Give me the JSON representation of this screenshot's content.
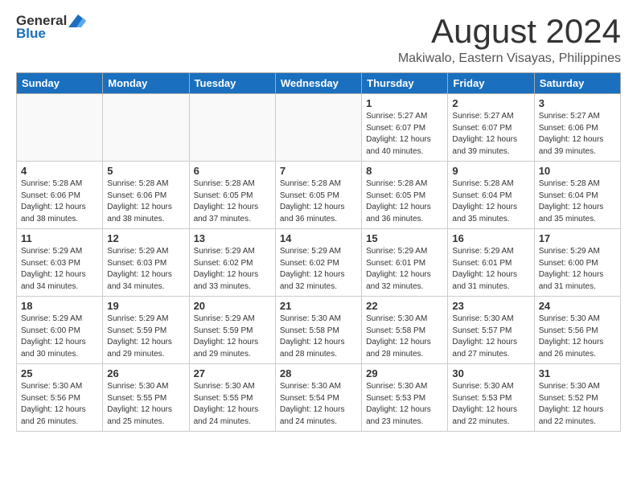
{
  "logo": {
    "general": "General",
    "blue": "Blue"
  },
  "title": "August 2024",
  "location": "Makiwalo, Eastern Visayas, Philippines",
  "days_header": [
    "Sunday",
    "Monday",
    "Tuesday",
    "Wednesday",
    "Thursday",
    "Friday",
    "Saturday"
  ],
  "weeks": [
    [
      {
        "day": "",
        "info": ""
      },
      {
        "day": "",
        "info": ""
      },
      {
        "day": "",
        "info": ""
      },
      {
        "day": "",
        "info": ""
      },
      {
        "day": "1",
        "info": "Sunrise: 5:27 AM\nSunset: 6:07 PM\nDaylight: 12 hours\nand 40 minutes."
      },
      {
        "day": "2",
        "info": "Sunrise: 5:27 AM\nSunset: 6:07 PM\nDaylight: 12 hours\nand 39 minutes."
      },
      {
        "day": "3",
        "info": "Sunrise: 5:27 AM\nSunset: 6:06 PM\nDaylight: 12 hours\nand 39 minutes."
      }
    ],
    [
      {
        "day": "4",
        "info": "Sunrise: 5:28 AM\nSunset: 6:06 PM\nDaylight: 12 hours\nand 38 minutes."
      },
      {
        "day": "5",
        "info": "Sunrise: 5:28 AM\nSunset: 6:06 PM\nDaylight: 12 hours\nand 38 minutes."
      },
      {
        "day": "6",
        "info": "Sunrise: 5:28 AM\nSunset: 6:05 PM\nDaylight: 12 hours\nand 37 minutes."
      },
      {
        "day": "7",
        "info": "Sunrise: 5:28 AM\nSunset: 6:05 PM\nDaylight: 12 hours\nand 36 minutes."
      },
      {
        "day": "8",
        "info": "Sunrise: 5:28 AM\nSunset: 6:05 PM\nDaylight: 12 hours\nand 36 minutes."
      },
      {
        "day": "9",
        "info": "Sunrise: 5:28 AM\nSunset: 6:04 PM\nDaylight: 12 hours\nand 35 minutes."
      },
      {
        "day": "10",
        "info": "Sunrise: 5:28 AM\nSunset: 6:04 PM\nDaylight: 12 hours\nand 35 minutes."
      }
    ],
    [
      {
        "day": "11",
        "info": "Sunrise: 5:29 AM\nSunset: 6:03 PM\nDaylight: 12 hours\nand 34 minutes."
      },
      {
        "day": "12",
        "info": "Sunrise: 5:29 AM\nSunset: 6:03 PM\nDaylight: 12 hours\nand 34 minutes."
      },
      {
        "day": "13",
        "info": "Sunrise: 5:29 AM\nSunset: 6:02 PM\nDaylight: 12 hours\nand 33 minutes."
      },
      {
        "day": "14",
        "info": "Sunrise: 5:29 AM\nSunset: 6:02 PM\nDaylight: 12 hours\nand 32 minutes."
      },
      {
        "day": "15",
        "info": "Sunrise: 5:29 AM\nSunset: 6:01 PM\nDaylight: 12 hours\nand 32 minutes."
      },
      {
        "day": "16",
        "info": "Sunrise: 5:29 AM\nSunset: 6:01 PM\nDaylight: 12 hours\nand 31 minutes."
      },
      {
        "day": "17",
        "info": "Sunrise: 5:29 AM\nSunset: 6:00 PM\nDaylight: 12 hours\nand 31 minutes."
      }
    ],
    [
      {
        "day": "18",
        "info": "Sunrise: 5:29 AM\nSunset: 6:00 PM\nDaylight: 12 hours\nand 30 minutes."
      },
      {
        "day": "19",
        "info": "Sunrise: 5:29 AM\nSunset: 5:59 PM\nDaylight: 12 hours\nand 29 minutes."
      },
      {
        "day": "20",
        "info": "Sunrise: 5:29 AM\nSunset: 5:59 PM\nDaylight: 12 hours\nand 29 minutes."
      },
      {
        "day": "21",
        "info": "Sunrise: 5:30 AM\nSunset: 5:58 PM\nDaylight: 12 hours\nand 28 minutes."
      },
      {
        "day": "22",
        "info": "Sunrise: 5:30 AM\nSunset: 5:58 PM\nDaylight: 12 hours\nand 28 minutes."
      },
      {
        "day": "23",
        "info": "Sunrise: 5:30 AM\nSunset: 5:57 PM\nDaylight: 12 hours\nand 27 minutes."
      },
      {
        "day": "24",
        "info": "Sunrise: 5:30 AM\nSunset: 5:56 PM\nDaylight: 12 hours\nand 26 minutes."
      }
    ],
    [
      {
        "day": "25",
        "info": "Sunrise: 5:30 AM\nSunset: 5:56 PM\nDaylight: 12 hours\nand 26 minutes."
      },
      {
        "day": "26",
        "info": "Sunrise: 5:30 AM\nSunset: 5:55 PM\nDaylight: 12 hours\nand 25 minutes."
      },
      {
        "day": "27",
        "info": "Sunrise: 5:30 AM\nSunset: 5:55 PM\nDaylight: 12 hours\nand 24 minutes."
      },
      {
        "day": "28",
        "info": "Sunrise: 5:30 AM\nSunset: 5:54 PM\nDaylight: 12 hours\nand 24 minutes."
      },
      {
        "day": "29",
        "info": "Sunrise: 5:30 AM\nSunset: 5:53 PM\nDaylight: 12 hours\nand 23 minutes."
      },
      {
        "day": "30",
        "info": "Sunrise: 5:30 AM\nSunset: 5:53 PM\nDaylight: 12 hours\nand 22 minutes."
      },
      {
        "day": "31",
        "info": "Sunrise: 5:30 AM\nSunset: 5:52 PM\nDaylight: 12 hours\nand 22 minutes."
      }
    ]
  ]
}
